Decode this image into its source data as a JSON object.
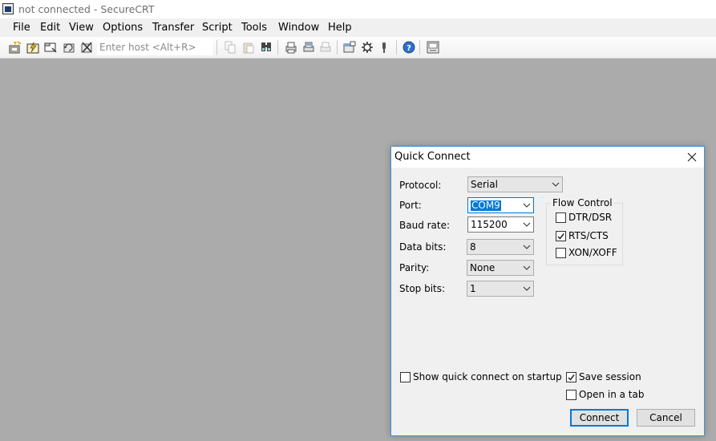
{
  "window": {
    "title": "not connected - SecureCRT"
  },
  "menu": [
    "File",
    "Edit",
    "View",
    "Options",
    "Transfer",
    "Script",
    "Tools",
    "Window",
    "Help"
  ],
  "toolbar": {
    "host_placeholder": "Enter host <Alt+R>",
    "icons": [
      "connect-icon",
      "quick-connect-icon",
      "connect-in-tab-icon",
      "reconnect-icon",
      "disconnect-icon",
      "copy-icon",
      "paste-icon",
      "find-icon",
      "print-icon",
      "print-selection-icon",
      "print-setup-icon",
      "session-options-icon",
      "global-options-icon",
      "keymap-icon",
      "help-icon",
      "sftp-icon"
    ]
  },
  "dialog": {
    "title": "Quick Connect",
    "fields": {
      "protocol": {
        "label": "Protocol:",
        "value": "Serial"
      },
      "port": {
        "label": "Port:",
        "value": "COM9"
      },
      "baud": {
        "label": "Baud rate:",
        "value": "115200"
      },
      "data_bits": {
        "label": "Data bits:",
        "value": "8"
      },
      "parity": {
        "label": "Parity:",
        "value": "None"
      },
      "stop_bits": {
        "label": "Stop bits:",
        "value": "1"
      }
    },
    "flow_control": {
      "title": "Flow Control",
      "dtr": {
        "label": "DTR/DSR",
        "checked": false
      },
      "rts": {
        "label": "RTS/CTS",
        "checked": true
      },
      "xon": {
        "label": "XON/XOFF",
        "checked": false
      }
    },
    "show_on_startup": {
      "label": "Show quick connect on startup",
      "checked": false
    },
    "save_session": {
      "label": "Save session",
      "checked": true
    },
    "open_in_tab": {
      "label": "Open in a tab",
      "checked": false
    },
    "buttons": {
      "connect": "Connect",
      "cancel": "Cancel"
    }
  },
  "colors": {
    "workspace": "#ababab",
    "accent": "#0078d7"
  }
}
